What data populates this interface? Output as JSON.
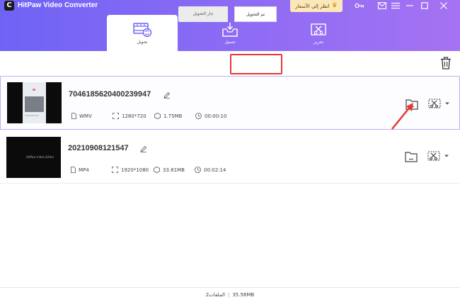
{
  "window": {
    "title": "HitPaw Video Converter",
    "logo_letter": "C",
    "price_label": "انظر إلى الأسعار"
  },
  "nav": {
    "tabs": [
      {
        "label": "تحويل",
        "icon": "film-convert-icon",
        "active": true
      },
      {
        "label": "تحميل",
        "icon": "download-tray-icon",
        "active": false
      },
      {
        "label": "تحرير",
        "icon": "crop-edit-icon",
        "active": false
      }
    ]
  },
  "toolbar": {
    "converting_label": "جار التحويل",
    "converted_label": "تم التحويل"
  },
  "files": [
    {
      "name": "7046185620400239947",
      "format": "WMV",
      "resolution": "1280*720",
      "size": "1.75MB",
      "duration": "00:00:10",
      "thumb_text": ""
    },
    {
      "name": "20210908121547",
      "format": "MP4",
      "resolution": "1920*1080",
      "size": "33.81MB",
      "duration": "00:02:14",
      "thumb_text": "HitPaw Video Editor"
    }
  ],
  "footer": {
    "files_label": "الملفات2",
    "separator": "|",
    "total_size": "35.56MB"
  },
  "colors": {
    "header_start": "#6f63f5",
    "header_end": "#a472f2",
    "highlight_red": "#e53935",
    "selected_border": "#b9b1f7"
  }
}
